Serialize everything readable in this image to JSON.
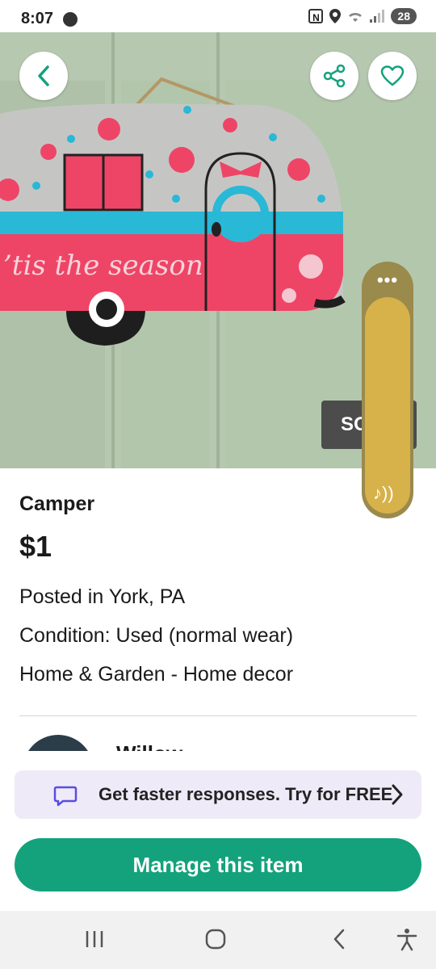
{
  "status": {
    "time": "8:07",
    "battery": "28",
    "nfc": "N"
  },
  "listing": {
    "sold_label": "SOLD",
    "title": "Camper",
    "price": "$1",
    "posted": "Posted in York, PA",
    "condition": "Condition: Used (normal wear)",
    "category": "Home & Garden - Home decor",
    "seller_name": "Willow"
  },
  "hero_image": {
    "caption": "'tis the season",
    "colors": {
      "door": "#b6c8b0",
      "sign_top": "#c8c8c8",
      "sign_pink": "#ee4567",
      "sign_blue": "#29b8d6"
    }
  },
  "floating_panel": {
    "dots": "•••",
    "icon": "music-note-icon"
  },
  "promo": {
    "text": "Get faster responses. Try for FREE",
    "icon": "chat-bubble-icon"
  },
  "primary_action": {
    "label": "Manage this item",
    "color": "#14a27d"
  },
  "nav": {
    "items": [
      "recent-apps-icon",
      "home-icon",
      "back-icon",
      "accessibility-icon"
    ]
  }
}
